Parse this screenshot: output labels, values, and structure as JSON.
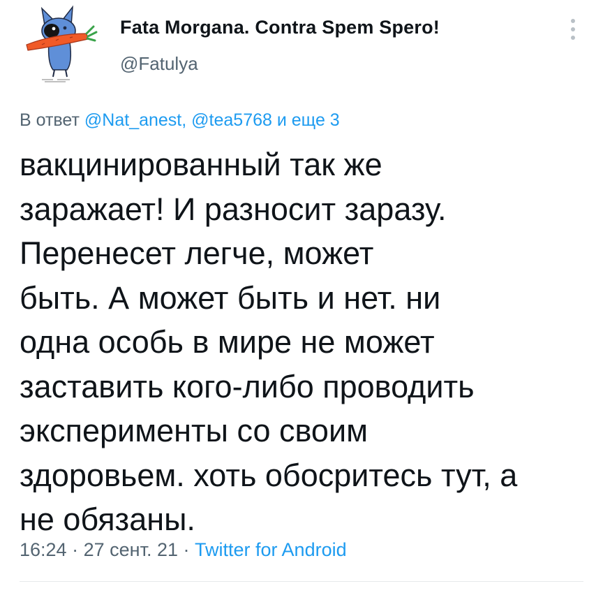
{
  "author": {
    "display_name": "Fata Morgana. Contra Spem Spero!",
    "handle": "@Fatulya",
    "avatar_icon": "blue-cat-with-carrot-avatar"
  },
  "reply": {
    "prefix": "В ответ",
    "mention_1": "@Nat_anest,",
    "mention_2": "@tea5768",
    "suffix": "и еще 3"
  },
  "tweet": {
    "lines": [
      "вакцинированный так же",
      "заражает! И разносит заразу.",
      "Перенесет легче, может",
      "быть. А может быть и нет. ни",
      "одна особь в мире не может",
      "заставить кого-либо проводить",
      "эксперименты со своим",
      "здоровьем. хоть обосритесь тут, а",
      "не обязаны."
    ]
  },
  "meta": {
    "time": "16:24",
    "sep1": "·",
    "date": "27 сент. 21",
    "sep2": "·",
    "source": "Twitter for Android"
  },
  "colors": {
    "text": "#0f1419",
    "secondary": "#536471",
    "link": "#1d9bf0"
  }
}
